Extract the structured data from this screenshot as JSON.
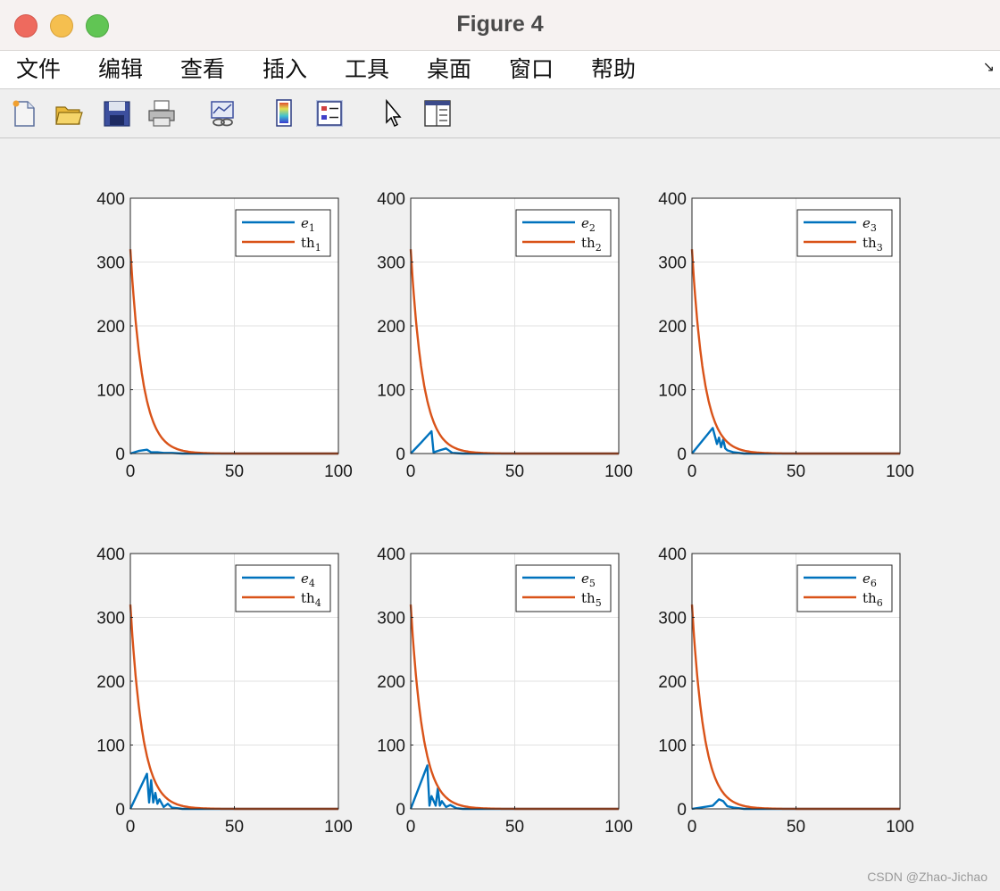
{
  "window": {
    "title": "Figure 4",
    "buttons": [
      "close",
      "minimize",
      "zoom"
    ]
  },
  "menubar": {
    "items": [
      {
        "label": "文件"
      },
      {
        "label": "编辑"
      },
      {
        "label": "查看"
      },
      {
        "label": "插入"
      },
      {
        "label": "工具"
      },
      {
        "label": "桌面"
      },
      {
        "label": "窗口"
      },
      {
        "label": "帮助"
      }
    ],
    "overflow_icon": "dock-arrow-icon"
  },
  "toolbar": {
    "icons": [
      "new-figure-icon",
      "open-file-icon",
      "save-icon",
      "print-icon",
      "link-plot-icon",
      "colorbar-icon",
      "legend-icon",
      "pointer-icon",
      "property-editor-icon"
    ]
  },
  "watermark": "CSDN @Zhao-Jichao",
  "colors": {
    "series_e": "#0072bd",
    "series_th": "#d95319"
  },
  "chart_data": [
    {
      "type": "line",
      "xlim": [
        0,
        100
      ],
      "ylim": [
        0,
        400
      ],
      "xticks": [
        "0",
        "50",
        "100"
      ],
      "yticks": [
        "0",
        "100",
        "200",
        "300",
        "400"
      ],
      "grid": true,
      "legend_placement": "top-right",
      "legend": [
        {
          "var": "e",
          "sub": "1"
        },
        {
          "var": "th",
          "sub": "1"
        }
      ],
      "series": [
        {
          "key": "e",
          "color": "#0072bd",
          "x": [
            0,
            4,
            8,
            10,
            13,
            16,
            20,
            25,
            100
          ],
          "y": [
            0,
            4,
            6,
            2,
            2,
            1,
            1,
            0,
            0
          ]
        },
        {
          "key": "th",
          "color": "#d95319",
          "decay": {
            "y0": 320,
            "tau": 5.9
          }
        }
      ]
    },
    {
      "type": "line",
      "xlim": [
        0,
        100
      ],
      "ylim": [
        0,
        400
      ],
      "xticks": [
        "0",
        "50",
        "100"
      ],
      "yticks": [
        "0",
        "100",
        "200",
        "300",
        "400"
      ],
      "grid": true,
      "legend_placement": "top-right",
      "legend": [
        {
          "var": "e",
          "sub": "2"
        },
        {
          "var": "th",
          "sub": "2"
        }
      ],
      "series": [
        {
          "key": "e",
          "color": "#0072bd",
          "x": [
            0,
            5,
            10,
            11,
            14,
            17,
            20,
            25,
            100
          ],
          "y": [
            0,
            17,
            35,
            2,
            5,
            8,
            1,
            0,
            0
          ]
        },
        {
          "key": "th",
          "color": "#d95319",
          "decay": {
            "y0": 320,
            "tau": 5.9
          }
        }
      ]
    },
    {
      "type": "line",
      "xlim": [
        0,
        100
      ],
      "ylim": [
        0,
        400
      ],
      "xticks": [
        "0",
        "50",
        "100"
      ],
      "yticks": [
        "0",
        "100",
        "200",
        "300",
        "400"
      ],
      "grid": true,
      "legend_placement": "top-right",
      "legend": [
        {
          "var": "e",
          "sub": "3"
        },
        {
          "var": "th",
          "sub": "3"
        }
      ],
      "series": [
        {
          "key": "e",
          "color": "#0072bd",
          "x": [
            0,
            10,
            12,
            13,
            14,
            15,
            16,
            17,
            20,
            25,
            100
          ],
          "y": [
            0,
            40,
            15,
            25,
            10,
            22,
            8,
            5,
            2,
            0,
            0
          ]
        },
        {
          "key": "th",
          "color": "#d95319",
          "decay": {
            "y0": 320,
            "tau": 5.9
          }
        }
      ]
    },
    {
      "type": "line",
      "xlim": [
        0,
        100
      ],
      "ylim": [
        0,
        400
      ],
      "xticks": [
        "0",
        "50",
        "100"
      ],
      "yticks": [
        "0",
        "100",
        "200",
        "300",
        "400"
      ],
      "grid": true,
      "legend_placement": "top-right",
      "legend": [
        {
          "var": "e",
          "sub": "4"
        },
        {
          "var": "th",
          "sub": "4"
        }
      ],
      "series": [
        {
          "key": "e",
          "color": "#0072bd",
          "x": [
            0,
            8,
            9,
            10,
            11,
            12,
            13,
            14,
            16,
            18,
            20,
            25,
            100
          ],
          "y": [
            0,
            55,
            10,
            45,
            10,
            25,
            8,
            15,
            3,
            8,
            2,
            0,
            0
          ]
        },
        {
          "key": "th",
          "color": "#d95319",
          "decay": {
            "y0": 320,
            "tau": 5.9
          }
        }
      ]
    },
    {
      "type": "line",
      "xlim": [
        0,
        100
      ],
      "ylim": [
        0,
        400
      ],
      "xticks": [
        "0",
        "50",
        "100"
      ],
      "yticks": [
        "0",
        "100",
        "200",
        "300",
        "400"
      ],
      "grid": true,
      "legend_placement": "top-right",
      "legend": [
        {
          "var": "e",
          "sub": "5"
        },
        {
          "var": "th",
          "sub": "5"
        }
      ],
      "series": [
        {
          "key": "e",
          "color": "#0072bd",
          "x": [
            0,
            8,
            9,
            10,
            12,
            13,
            14,
            15,
            17,
            19,
            22,
            25,
            100
          ],
          "y": [
            0,
            68,
            5,
            20,
            5,
            32,
            5,
            12,
            3,
            6,
            1,
            0,
            0
          ]
        },
        {
          "key": "th",
          "color": "#d95319",
          "decay": {
            "y0": 320,
            "tau": 5.9
          }
        }
      ]
    },
    {
      "type": "line",
      "xlim": [
        0,
        100
      ],
      "ylim": [
        0,
        400
      ],
      "xticks": [
        "0",
        "50",
        "100"
      ],
      "yticks": [
        "0",
        "100",
        "200",
        "300",
        "400"
      ],
      "grid": true,
      "legend_placement": "top-right",
      "legend": [
        {
          "var": "e",
          "sub": "6"
        },
        {
          "var": "th",
          "sub": "6"
        }
      ],
      "series": [
        {
          "key": "e",
          "color": "#0072bd",
          "x": [
            0,
            10,
            13,
            15,
            17,
            20,
            25,
            100
          ],
          "y": [
            0,
            5,
            15,
            12,
            4,
            2,
            0,
            0
          ]
        },
        {
          "key": "th",
          "color": "#d95319",
          "decay": {
            "y0": 320,
            "tau": 5.9
          }
        }
      ]
    }
  ]
}
